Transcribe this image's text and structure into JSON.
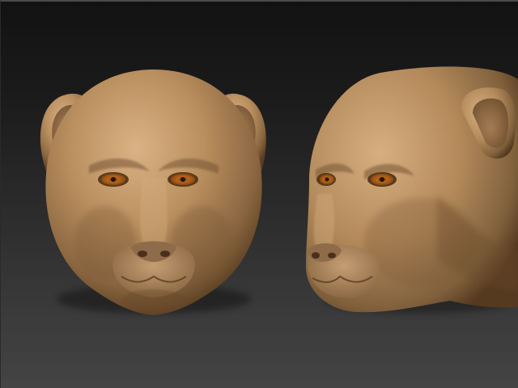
{
  "viewport": {
    "background_top": "#121212",
    "background_bottom": "#444444"
  },
  "models": [
    {
      "name": "lioness-head-front-view",
      "view": "front"
    },
    {
      "name": "lioness-head-three-quarter-view",
      "view": "three-quarter"
    }
  ],
  "material": {
    "skin_base": "#b48a5a",
    "skin_highlight": "#d8b083",
    "skin_shadow": "#5e4124",
    "eye_iris": "#c8771a",
    "nose": "#8a6a4a"
  }
}
